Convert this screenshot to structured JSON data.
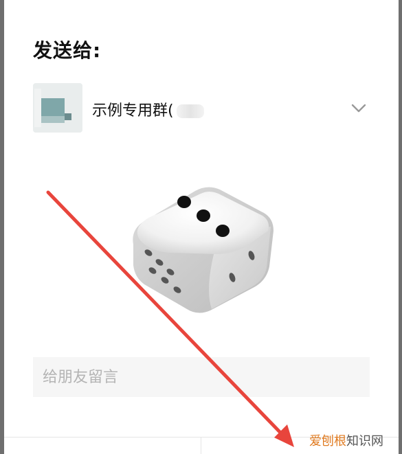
{
  "dialog": {
    "title": "发送给:",
    "recipient": {
      "name": "示例专用群("
    },
    "message": {
      "placeholder": "给朋友留言",
      "value": ""
    }
  },
  "sticker": {
    "icon": "dice-three-icon"
  },
  "annotation": {
    "arrow_color": "#e8453c"
  },
  "watermark": {
    "part1": "爱刨根",
    "part2": "知识网"
  },
  "colors": {
    "overlay": "#6f6f6f",
    "input_bg": "#f6f6f6",
    "title": "#111111"
  }
}
